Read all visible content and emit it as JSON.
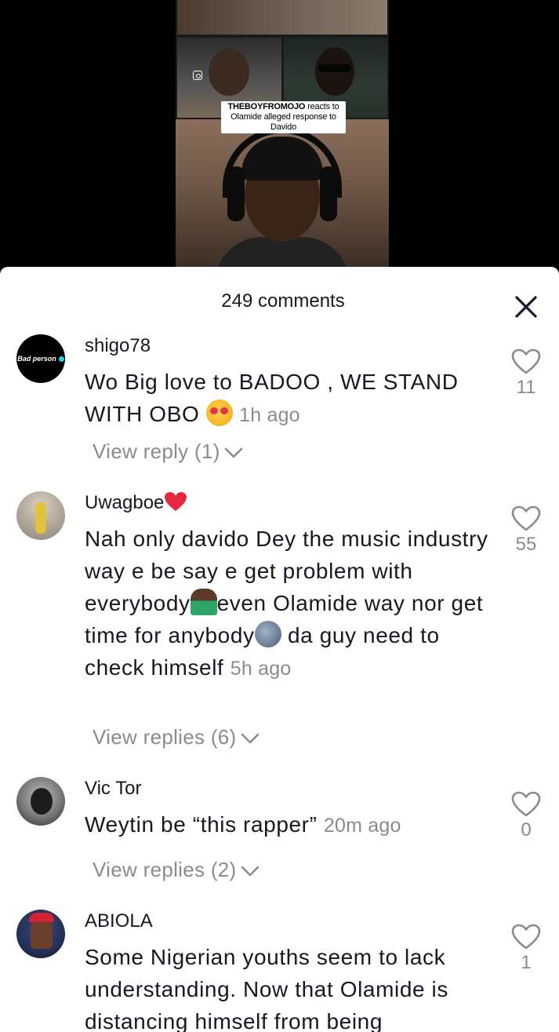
{
  "video": {
    "caption_bold": "THEBOYFROMOJO",
    "caption_rest": " reacts to Olamide alleged response to Davido"
  },
  "sheet": {
    "title": "249 comments"
  },
  "comments": [
    {
      "username": "shigo78",
      "avatar_text": "Bad person",
      "text": "Wo Big love to BADOO , WE STAND WITH OBO ",
      "time": "1h ago",
      "likes": "11",
      "replies": "View reply (1)"
    },
    {
      "username": "Uwagboe",
      "text_1": "Nah only davido Dey the music industry way e be say e get problem with everybody",
      "text_2": "even Olamide way nor get time for anybody",
      "text_3": " da guy need to check himself ",
      "time": "5h ago",
      "likes": "55",
      "replies": "View replies (6)"
    },
    {
      "username": "Vic Tor",
      "text": "Weytin be “this rapper” ",
      "time": "20m ago",
      "likes": "0",
      "replies": "View replies (2)"
    },
    {
      "username": "ABIOLA",
      "text": "Some Nigerian youths seem to lack understanding. Now that Olamide is distancing himself from being",
      "likes": "1"
    }
  ],
  "colors": {
    "text_primary": "#161823",
    "text_secondary": "#8a8b91",
    "sheet_bg": "#ffffff",
    "backdrop": "#000000"
  },
  "icons": [
    "instagram-icon",
    "close-icon",
    "heart-outline-icon",
    "chevron-down-icon",
    "verified-badge-icon"
  ]
}
